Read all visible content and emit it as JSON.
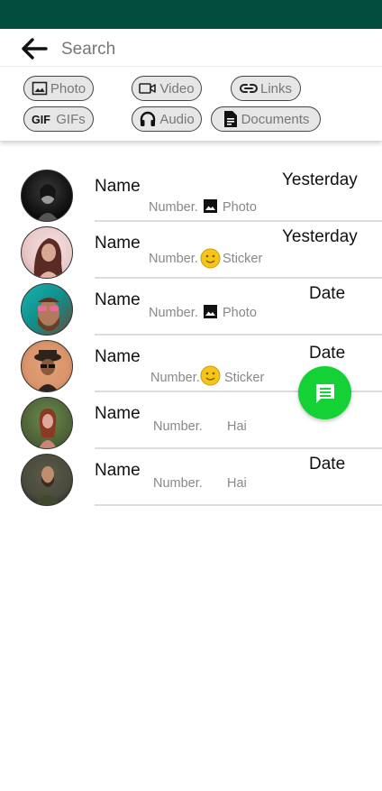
{
  "header": {
    "search_placeholder": "Search"
  },
  "filters": [
    {
      "label": "Photo",
      "icon": "image-icon"
    },
    {
      "label": "Video",
      "icon": "video-icon"
    },
    {
      "label": "Links",
      "icon": "link-icon"
    },
    {
      "label": "GIFs",
      "icon": "gif-icon"
    },
    {
      "label": "Audio",
      "icon": "headphones-icon"
    },
    {
      "label": "Documents",
      "icon": "document-icon"
    }
  ],
  "chats": [
    {
      "name": "Name",
      "date": "Yesterday",
      "number": "Number.",
      "message": "Photo",
      "message_icon": "image-icon",
      "avatar_colors": [
        "#0c0c0c",
        "#3a3a3a"
      ]
    },
    {
      "name": "Name",
      "date": "Yesterday",
      "number": "Number.",
      "message": "Sticker",
      "message_icon": "smiley-icon",
      "avatar_colors": [
        "#f3dfe0",
        "#5a2a24"
      ]
    },
    {
      "name": "Name",
      "date": "Date",
      "number": "Number.",
      "message": "Photo",
      "message_icon": "image-icon",
      "avatar_colors": [
        "#17b3ad",
        "#7a4a2c"
      ]
    },
    {
      "name": "Name",
      "date": "Date",
      "number": "Number.",
      "message": "Sticker",
      "message_icon": "smiley-icon",
      "avatar_colors": [
        "#d9946a",
        "#2d231c"
      ]
    },
    {
      "name": "Name",
      "date": "",
      "number": "Number.",
      "message": "Hai",
      "message_icon": "",
      "avatar_colors": [
        "#4a5e35",
        "#c8847a"
      ]
    },
    {
      "name": "Name",
      "date": "Date",
      "number": "Number.",
      "message": "Hai",
      "message_icon": "",
      "avatar_colors": [
        "#4b4b3d",
        "#1c1c1c"
      ]
    }
  ],
  "colors": {
    "status_bar": "#034d3e",
    "fab": "#14d135",
    "sticker": "#f5c518"
  },
  "fab": {
    "icon": "chat-icon"
  }
}
